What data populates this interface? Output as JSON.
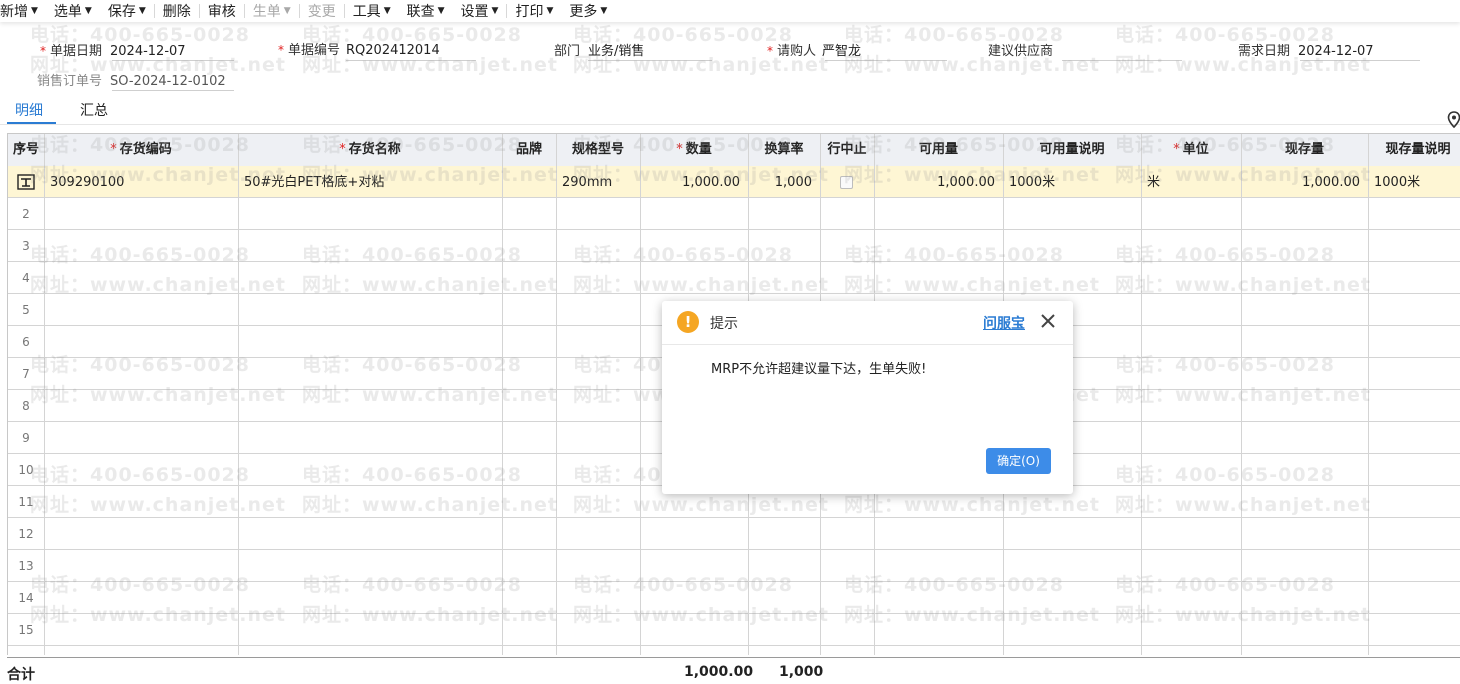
{
  "toolbar": {
    "items": [
      {
        "label": "新增",
        "dropdown": true,
        "disabled": false
      },
      {
        "label": "选单",
        "dropdown": true,
        "disabled": false
      },
      {
        "label": "保存",
        "dropdown": true,
        "disabled": false
      },
      {
        "label": "删除",
        "dropdown": false,
        "disabled": false
      },
      {
        "label": "审核",
        "dropdown": false,
        "disabled": false
      },
      {
        "label": "生单",
        "dropdown": true,
        "disabled": true
      },
      {
        "label": "变更",
        "dropdown": false,
        "disabled": true
      },
      {
        "label": "工具",
        "dropdown": true,
        "disabled": false
      },
      {
        "label": "联查",
        "dropdown": true,
        "disabled": false
      },
      {
        "label": "设置",
        "dropdown": true,
        "disabled": false
      },
      {
        "label": "打印",
        "dropdown": true,
        "disabled": false
      },
      {
        "label": "更多",
        "dropdown": true,
        "disabled": false
      }
    ]
  },
  "header": {
    "doc_date_label": "单据日期",
    "doc_date": "2024-12-07",
    "doc_no_label": "单据编号",
    "doc_no": "RQ202412014",
    "dept_label": "部门",
    "dept": "业务/销售",
    "requester_label": "请购人",
    "requester": "严智龙",
    "supplier_label": "建议供应商",
    "supplier": "",
    "need_date_label": "需求日期",
    "need_date": "2024-12-07",
    "sales_order_label": "销售订单号",
    "sales_order": "SO-2024-12-0102"
  },
  "tabs": [
    "明细",
    "汇总"
  ],
  "table": {
    "columns": [
      {
        "label": "序号",
        "required": false
      },
      {
        "label": "存货编码",
        "required": true
      },
      {
        "label": "存货名称",
        "required": true
      },
      {
        "label": "品牌",
        "required": false
      },
      {
        "label": "规格型号",
        "required": false
      },
      {
        "label": "数量",
        "required": true
      },
      {
        "label": "换算率",
        "required": false
      },
      {
        "label": "行中止",
        "required": false
      },
      {
        "label": "可用量",
        "required": false
      },
      {
        "label": "可用量说明",
        "required": false
      },
      {
        "label": "单位",
        "required": true
      },
      {
        "label": "现存量",
        "required": false
      },
      {
        "label": "现存量说明",
        "required": false
      }
    ],
    "rows": [
      {
        "code": "309290100",
        "name": "50#光白PET格底+对粘",
        "brand": "",
        "spec": "290mm",
        "qty": "1,000.00",
        "rate": "1,000",
        "stopped": false,
        "avail": "1,000.00",
        "avail_note": "1000米",
        "unit": "米",
        "stock": "1,000.00",
        "stock_note": "1000米"
      }
    ],
    "row_numbers": [
      "2",
      "3",
      "4",
      "5",
      "6",
      "7",
      "8",
      "9",
      "10",
      "11",
      "12",
      "13",
      "14",
      "15"
    ],
    "summary": {
      "label": "合计",
      "qty": "1,000.00",
      "rate": "1,000"
    }
  },
  "watermark": {
    "phone": "电话：400-665-0028",
    "site": "网址：www.chanjet.net"
  },
  "dialog": {
    "title": "提示",
    "help_link": "问服宝",
    "message": "MRP不允许超建议量下达，生单失败!",
    "ok_label": "确定(O)"
  },
  "colors": {
    "accent": "#2b7cd3",
    "warning": "#f5a623",
    "required": "#e02020",
    "selected_row": "#fef6d4",
    "ok_button": "#3d8ce8"
  }
}
